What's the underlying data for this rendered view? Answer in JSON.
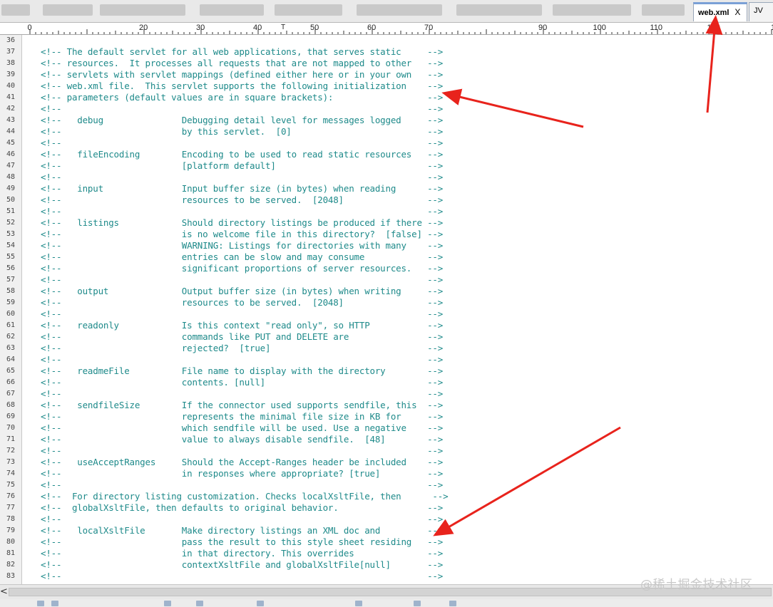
{
  "tabs": [
    {
      "label": "web.xml",
      "active": true,
      "close": "X"
    },
    {
      "label": "JV",
      "active": false
    }
  ],
  "ruler": {
    "labels": [
      "0",
      "20",
      "30",
      "40",
      "50",
      "60",
      "70",
      "90",
      "100",
      "110",
      "120",
      "13"
    ],
    "caret": "T"
  },
  "editor": {
    "line_numbers": [
      "36",
      "37",
      "38",
      "39",
      "40",
      "41",
      "42",
      "43",
      "44",
      "45",
      "46",
      "47",
      "48",
      "49",
      "50",
      "51",
      "52",
      "53",
      "54",
      "55",
      "56",
      "57",
      "58",
      "59",
      "60",
      "61",
      "62",
      "63",
      "64",
      "65",
      "66",
      "67",
      "68",
      "69",
      "70",
      "71",
      "72",
      "73",
      "74",
      "75",
      "76",
      "77",
      "78",
      "79",
      "80",
      "81",
      "82",
      "83"
    ],
    "lines": [
      "",
      "<!-- The default servlet for all web applications, that serves static     -->",
      "<!-- resources.  It processes all requests that are not mapped to other   -->",
      "<!-- servlets with servlet mappings (defined either here or in your own   -->",
      "<!-- web.xml file.  This servlet supports the following initialization    -->",
      "<!-- parameters (default values are in square brackets):                  -->",
      "<!--                                                                      -->",
      "<!--   debug               Debugging detail level for messages logged     -->",
      "<!--                       by this servlet.  [0]                          -->",
      "<!--                                                                      -->",
      "<!--   fileEncoding        Encoding to be used to read static resources   -->",
      "<!--                       [platform default]                             -->",
      "<!--                                                                      -->",
      "<!--   input               Input buffer size (in bytes) when reading      -->",
      "<!--                       resources to be served.  [2048]                -->",
      "<!--                                                                      -->",
      "<!--   listings            Should directory listings be produced if there -->",
      "<!--                       is no welcome file in this directory?  [false] -->",
      "<!--                       WARNING: Listings for directories with many    -->",
      "<!--                       entries can be slow and may consume            -->",
      "<!--                       significant proportions of server resources.   -->",
      "<!--                                                                      -->",
      "<!--   output              Output buffer size (in bytes) when writing     -->",
      "<!--                       resources to be served.  [2048]                -->",
      "<!--                                                                      -->",
      "<!--   readonly            Is this context \"read only\", so HTTP           -->",
      "<!--                       commands like PUT and DELETE are               -->",
      "<!--                       rejected?  [true]                              -->",
      "<!--                                                                      -->",
      "<!--   readmeFile          File name to display with the directory        -->",
      "<!--                       contents. [null]                               -->",
      "<!--                                                                      -->",
      "<!--   sendfileSize        If the connector used supports sendfile, this  -->",
      "<!--                       represents the minimal file size in KB for     -->",
      "<!--                       which sendfile will be used. Use a negative    -->",
      "<!--                       value to always disable sendfile.  [48]        -->",
      "<!--                                                                      -->",
      "<!--   useAcceptRanges     Should the Accept-Ranges header be included    -->",
      "<!--                       in responses where appropriate? [true]         -->",
      "<!--                                                                      -->",
      "<!--  For directory listing customization. Checks localXsltFile, then      -->",
      "<!--  globalXsltFile, then defaults to original behavior.                 -->",
      "<!--                                                                      -->",
      "<!--   localXsltFile       Make directory listings an XML doc and         -->",
      "<!--                       pass the result to this style sheet residing   -->",
      "<!--                       in that directory. This overrides              -->",
      "<!--                       contextXsltFile and globalXsltFile[null]       -->",
      "<!--                                                                      -->"
    ]
  },
  "scrollbar": {
    "left_arrow": "<"
  },
  "watermark": "@稀土掘金技术社区",
  "colors": {
    "code": "#1e8a8a",
    "annotation_arrow": "#e8231c",
    "active_tab_accent": "#7aa0d6"
  }
}
